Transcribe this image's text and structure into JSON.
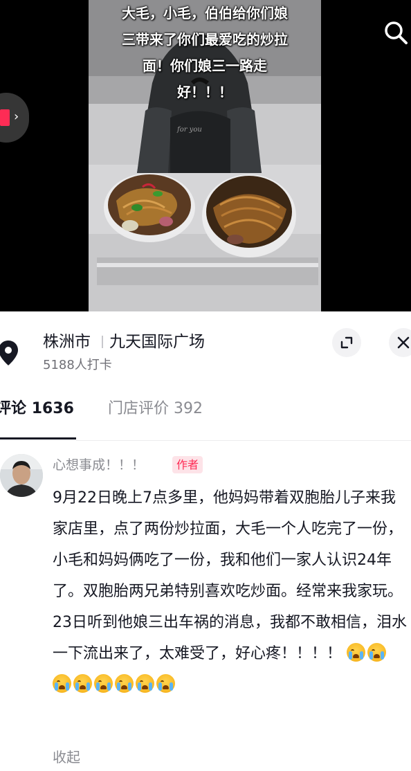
{
  "video": {
    "caption": "大毛，小毛，伯伯给你们娘\n三带来了你们最爱吃的炒拉\n面！你们娘三一路走\n好！！！",
    "search_icon": "search-icon",
    "side_icon": "gift-icon"
  },
  "location": {
    "city": "株洲市",
    "place": "九天国际广场",
    "checkins": "5188人打卡",
    "pin_icon": "location-pin-icon",
    "expand_icon": "expand-icon",
    "close_icon": "close-icon"
  },
  "tabs": {
    "comments_label": "评论",
    "comments_count": "1636",
    "reviews_label": "门店评价",
    "reviews_count": "392"
  },
  "comment": {
    "username": "心想事成！！！",
    "badge": "作者",
    "text": "9月22日晚上7点多里，他妈妈带着双胞胎儿子来我家店里，点了两份炒拉面，大毛一个人吃完了一份，小毛和妈妈俩吃了一份，我和他们一家人认识24年了。双胞胎两兄弟特别喜欢吃炒面。经常来我家玩。23日听到他娘三出车祸的消息，我都不敢相信，泪水一下流出来了，太难受了，好心疼！！！！",
    "emoji_name": "loudly-crying-emoji",
    "emoji_count": 8,
    "collapse": "收起"
  },
  "colors": {
    "accent": "#fe2c55",
    "text_primary": "#161823",
    "text_secondary": "#8a8b91"
  }
}
